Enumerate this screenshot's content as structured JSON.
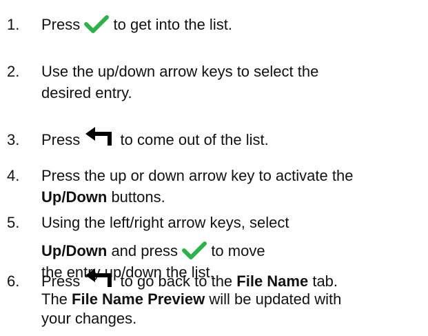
{
  "steps": [
    {
      "number": "1.",
      "pre": "Press",
      "icon": "checkmark-icon",
      "post": "to get into the list."
    },
    {
      "number": "2.",
      "line1": "Use the up/down arrow keys to select the",
      "line2": "desired entry."
    },
    {
      "number": "3.",
      "pre": "Press",
      "icon": "back-arrow-icon",
      "post": "to come out of the list."
    },
    {
      "number": "4.",
      "line1": "Press the up or down arrow key to activate the",
      "bold": "Up/Down",
      "line2_post": " buttons."
    },
    {
      "number": "5.",
      "line1": "Using the left/right arrow keys, select",
      "bold": "Up/Down",
      "mid": " and press",
      "icon": "checkmark-icon",
      "post": "to move",
      "line3": "the entry up/down the list."
    },
    {
      "number": "6.",
      "pre": "Press",
      "icon": "back-arrow-icon",
      "post": "to go back to the ",
      "bold1": "File Name",
      "post2": " tab.",
      "line2_pre": "The ",
      "bold2": "File Name Preview",
      "line2_post": " will be updated with",
      "line3": "your changes."
    }
  ],
  "colors": {
    "check": "#2db24a",
    "text": "#111111",
    "back_arrow": "#000000"
  }
}
